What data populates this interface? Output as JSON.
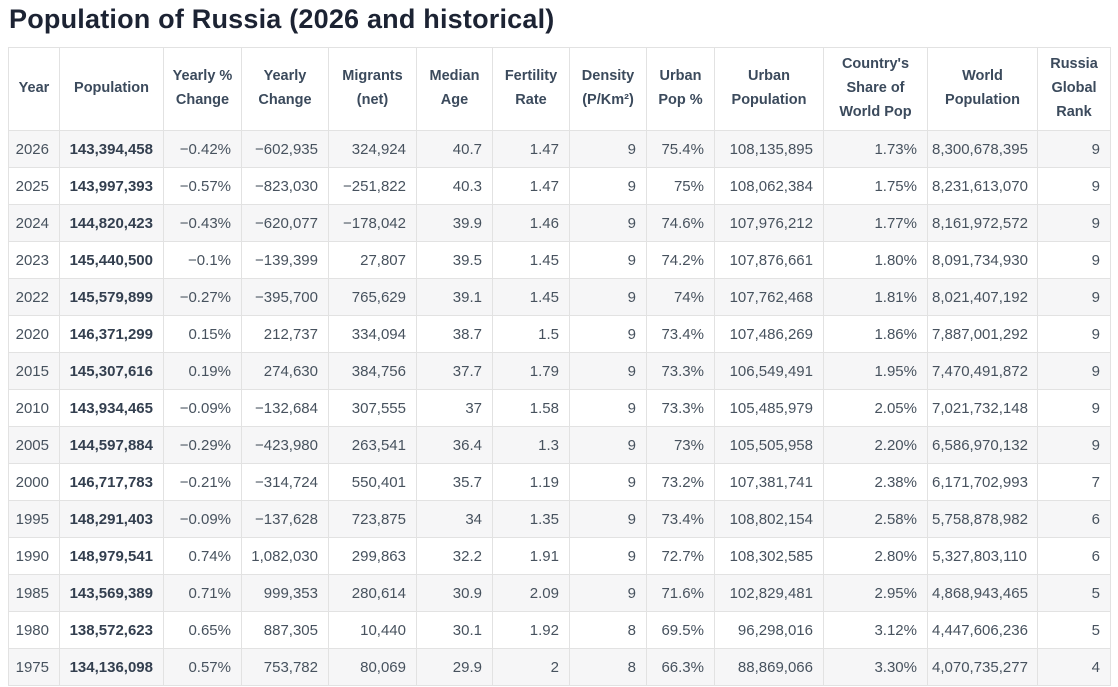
{
  "page": {
    "title": "Population of Russia (2026 and historical)"
  },
  "colors": {
    "title_text": "#1c2333",
    "header_text": "#3b4a5c",
    "cell_text": "#47525e",
    "population_text": "#333f4f",
    "stripe_row_bg": "#f6f6f7",
    "table_border": "#e2e2e2"
  },
  "table": {
    "columns": [
      {
        "key": "year",
        "label": "Year"
      },
      {
        "key": "population",
        "label": "Population"
      },
      {
        "key": "yearly-pct-change",
        "label": "Yearly % Change"
      },
      {
        "key": "yearly-change",
        "label": "Yearly Change"
      },
      {
        "key": "migrants-net",
        "label": "Migrants (net)"
      },
      {
        "key": "median-age",
        "label": "Median Age"
      },
      {
        "key": "fertility-rate",
        "label": "Fertility Rate"
      },
      {
        "key": "density",
        "label": "Density (P/Km²)"
      },
      {
        "key": "urban-pop-pct",
        "label": "Urban Pop %"
      },
      {
        "key": "urban-population",
        "label": "Urban Population"
      },
      {
        "key": "country-share-world-pop",
        "label": "Country's Share of World Pop"
      },
      {
        "key": "world-population",
        "label": "World Population"
      },
      {
        "key": "global-rank",
        "label": "Russia Global Rank"
      }
    ],
    "rows": [
      [
        "2026",
        "143,394,458",
        "−0.42%",
        "−602,935",
        "324,924",
        "40.7",
        "1.47",
        "9",
        "75.4%",
        "108,135,895",
        "1.73%",
        "8,300,678,395",
        "9"
      ],
      [
        "2025",
        "143,997,393",
        "−0.57%",
        "−823,030",
        "−251,822",
        "40.3",
        "1.47",
        "9",
        "75%",
        "108,062,384",
        "1.75%",
        "8,231,613,070",
        "9"
      ],
      [
        "2024",
        "144,820,423",
        "−0.43%",
        "−620,077",
        "−178,042",
        "39.9",
        "1.46",
        "9",
        "74.6%",
        "107,976,212",
        "1.77%",
        "8,161,972,572",
        "9"
      ],
      [
        "2023",
        "145,440,500",
        "−0.1%",
        "−139,399",
        "27,807",
        "39.5",
        "1.45",
        "9",
        "74.2%",
        "107,876,661",
        "1.80%",
        "8,091,734,930",
        "9"
      ],
      [
        "2022",
        "145,579,899",
        "−0.27%",
        "−395,700",
        "765,629",
        "39.1",
        "1.45",
        "9",
        "74%",
        "107,762,468",
        "1.81%",
        "8,021,407,192",
        "9"
      ],
      [
        "2020",
        "146,371,299",
        "0.15%",
        "212,737",
        "334,094",
        "38.7",
        "1.5",
        "9",
        "73.4%",
        "107,486,269",
        "1.86%",
        "7,887,001,292",
        "9"
      ],
      [
        "2015",
        "145,307,616",
        "0.19%",
        "274,630",
        "384,756",
        "37.7",
        "1.79",
        "9",
        "73.3%",
        "106,549,491",
        "1.95%",
        "7,470,491,872",
        "9"
      ],
      [
        "2010",
        "143,934,465",
        "−0.09%",
        "−132,684",
        "307,555",
        "37",
        "1.58",
        "9",
        "73.3%",
        "105,485,979",
        "2.05%",
        "7,021,732,148",
        "9"
      ],
      [
        "2005",
        "144,597,884",
        "−0.29%",
        "−423,980",
        "263,541",
        "36.4",
        "1.3",
        "9",
        "73%",
        "105,505,958",
        "2.20%",
        "6,586,970,132",
        "9"
      ],
      [
        "2000",
        "146,717,783",
        "−0.21%",
        "−314,724",
        "550,401",
        "35.7",
        "1.19",
        "9",
        "73.2%",
        "107,381,741",
        "2.38%",
        "6,171,702,993",
        "7"
      ],
      [
        "1995",
        "148,291,403",
        "−0.09%",
        "−137,628",
        "723,875",
        "34",
        "1.35",
        "9",
        "73.4%",
        "108,802,154",
        "2.58%",
        "5,758,878,982",
        "6"
      ],
      [
        "1990",
        "148,979,541",
        "0.74%",
        "1,082,030",
        "299,863",
        "32.2",
        "1.91",
        "9",
        "72.7%",
        "108,302,585",
        "2.80%",
        "5,327,803,110",
        "6"
      ],
      [
        "1985",
        "143,569,389",
        "0.71%",
        "999,353",
        "280,614",
        "30.9",
        "2.09",
        "9",
        "71.6%",
        "102,829,481",
        "2.95%",
        "4,868,943,465",
        "5"
      ],
      [
        "1980",
        "138,572,623",
        "0.65%",
        "887,305",
        "10,440",
        "30.1",
        "1.92",
        "8",
        "69.5%",
        "96,298,016",
        "3.12%",
        "4,447,606,236",
        "5"
      ],
      [
        "1975",
        "134,136,098",
        "0.57%",
        "753,782",
        "80,069",
        "29.9",
        "2",
        "8",
        "66.3%",
        "88,869,066",
        "3.30%",
        "4,070,735,277",
        "4"
      ]
    ]
  }
}
